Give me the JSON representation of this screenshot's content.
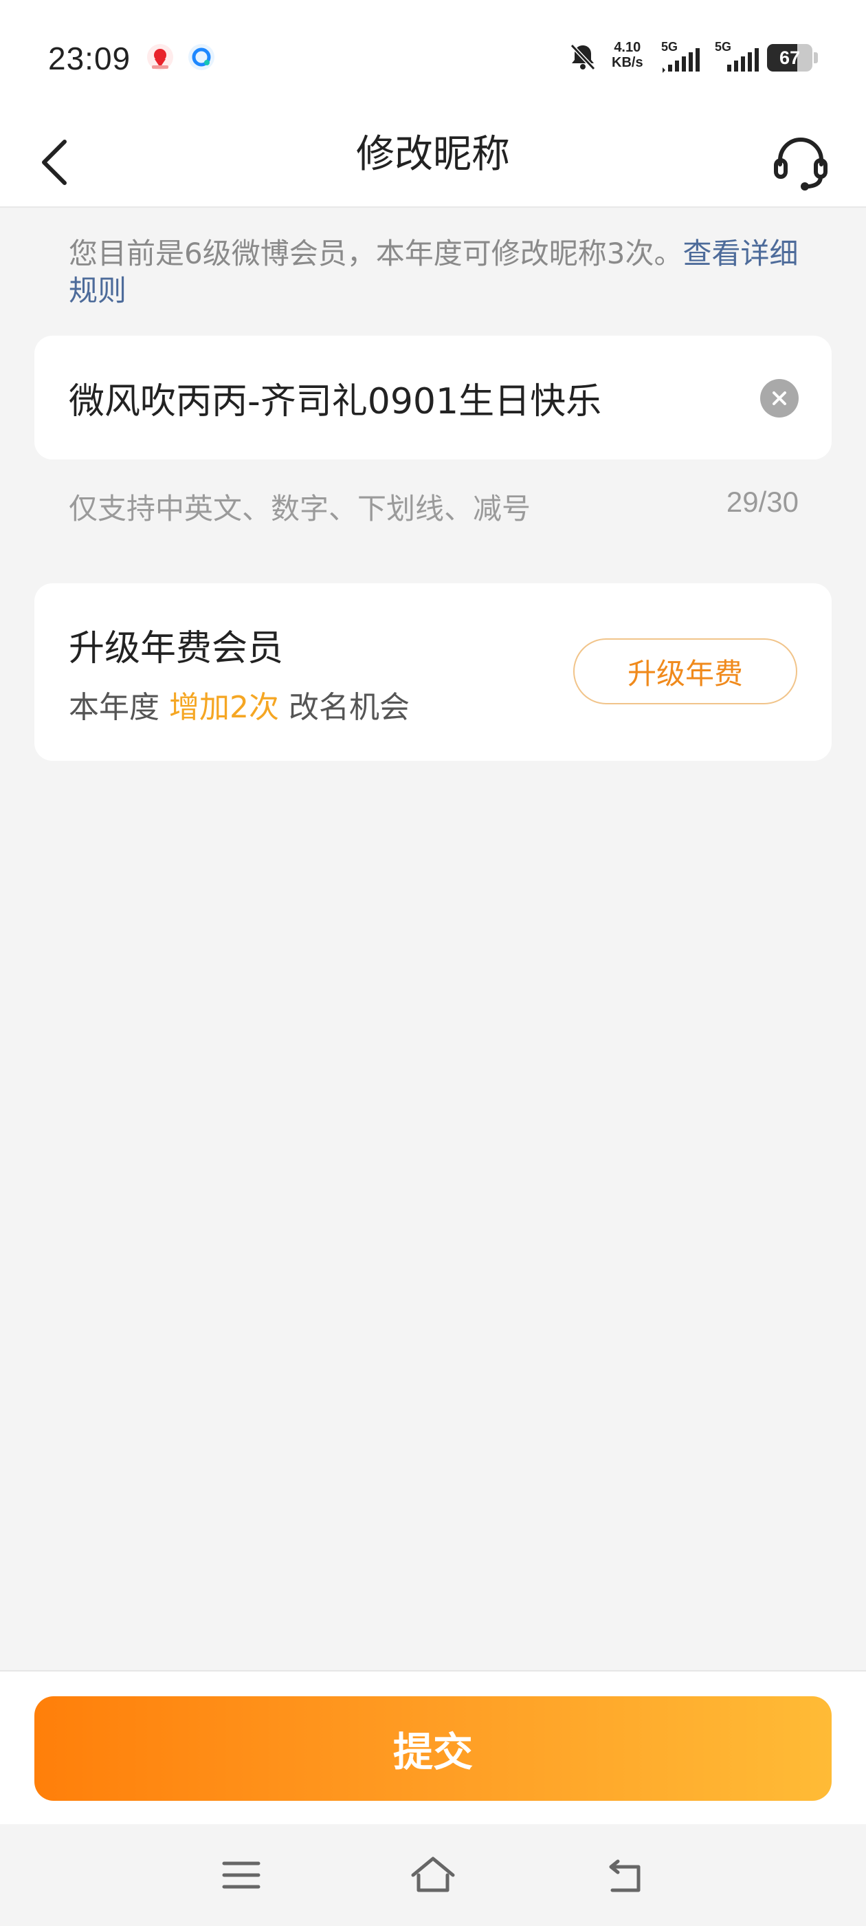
{
  "status_bar": {
    "time": "23:09",
    "network_speed_value": "4.10",
    "network_speed_unit": "KB/s",
    "signal1_label": "5G",
    "signal2_label": "5G",
    "battery_percent": "67",
    "battery_level": 0.67,
    "icons": [
      "app-notification-icon-red",
      "app-notification-icon-blue",
      "bell-off-icon",
      "signal-icon",
      "battery-icon"
    ]
  },
  "header": {
    "title": "修改昵称",
    "back_icon": "chevron-left-icon",
    "service_icon": "headset-icon"
  },
  "notice": {
    "text": "您目前是6级微博会员，本年度可修改昵称3次。",
    "link_text": "查看详细规则"
  },
  "nickname": {
    "value": "微风吹丙丙-齐司礼0901生日快乐",
    "clear_icon": "clear-icon",
    "hint": "仅支持中英文、数字、下划线、减号",
    "counter": "29/30"
  },
  "upgrade": {
    "title": "升级年费会员",
    "subtitle_prefix": "本年度 ",
    "subtitle_highlight": "增加2次",
    "subtitle_suffix": " 改名机会",
    "button_label": "升级年费",
    "highlight_color": "#f5a623",
    "button_color": "#f08a1c"
  },
  "footer": {
    "submit_label": "提交",
    "submit_gradient": [
      "#ff7f0a",
      "#ffbb36"
    ]
  },
  "system_nav": {
    "icons": [
      "menu-icon",
      "home-icon",
      "back-icon"
    ]
  }
}
